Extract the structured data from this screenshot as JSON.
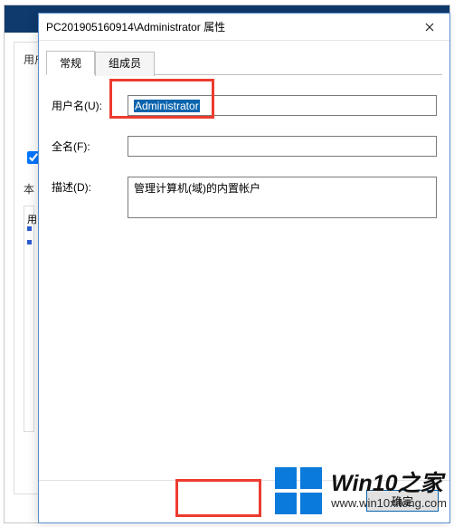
{
  "bg": {
    "label_users": "用户",
    "label_this": "本",
    "col_header": "用"
  },
  "dialog": {
    "title": "PC201905160914\\Administrator 属性",
    "tabs": [
      {
        "label": "常规"
      },
      {
        "label": "组成员"
      }
    ],
    "form": {
      "username_label": "用户名(U):",
      "username_value": "Administrator",
      "fullname_label": "全名(F):",
      "fullname_value": "",
      "description_label": "描述(D):",
      "description_value": "管理计算机(域)的内置帐户"
    },
    "buttons": {
      "ok": "确定"
    }
  },
  "watermark": {
    "title": "Win10之家",
    "url": "www.win10xitong.com"
  }
}
